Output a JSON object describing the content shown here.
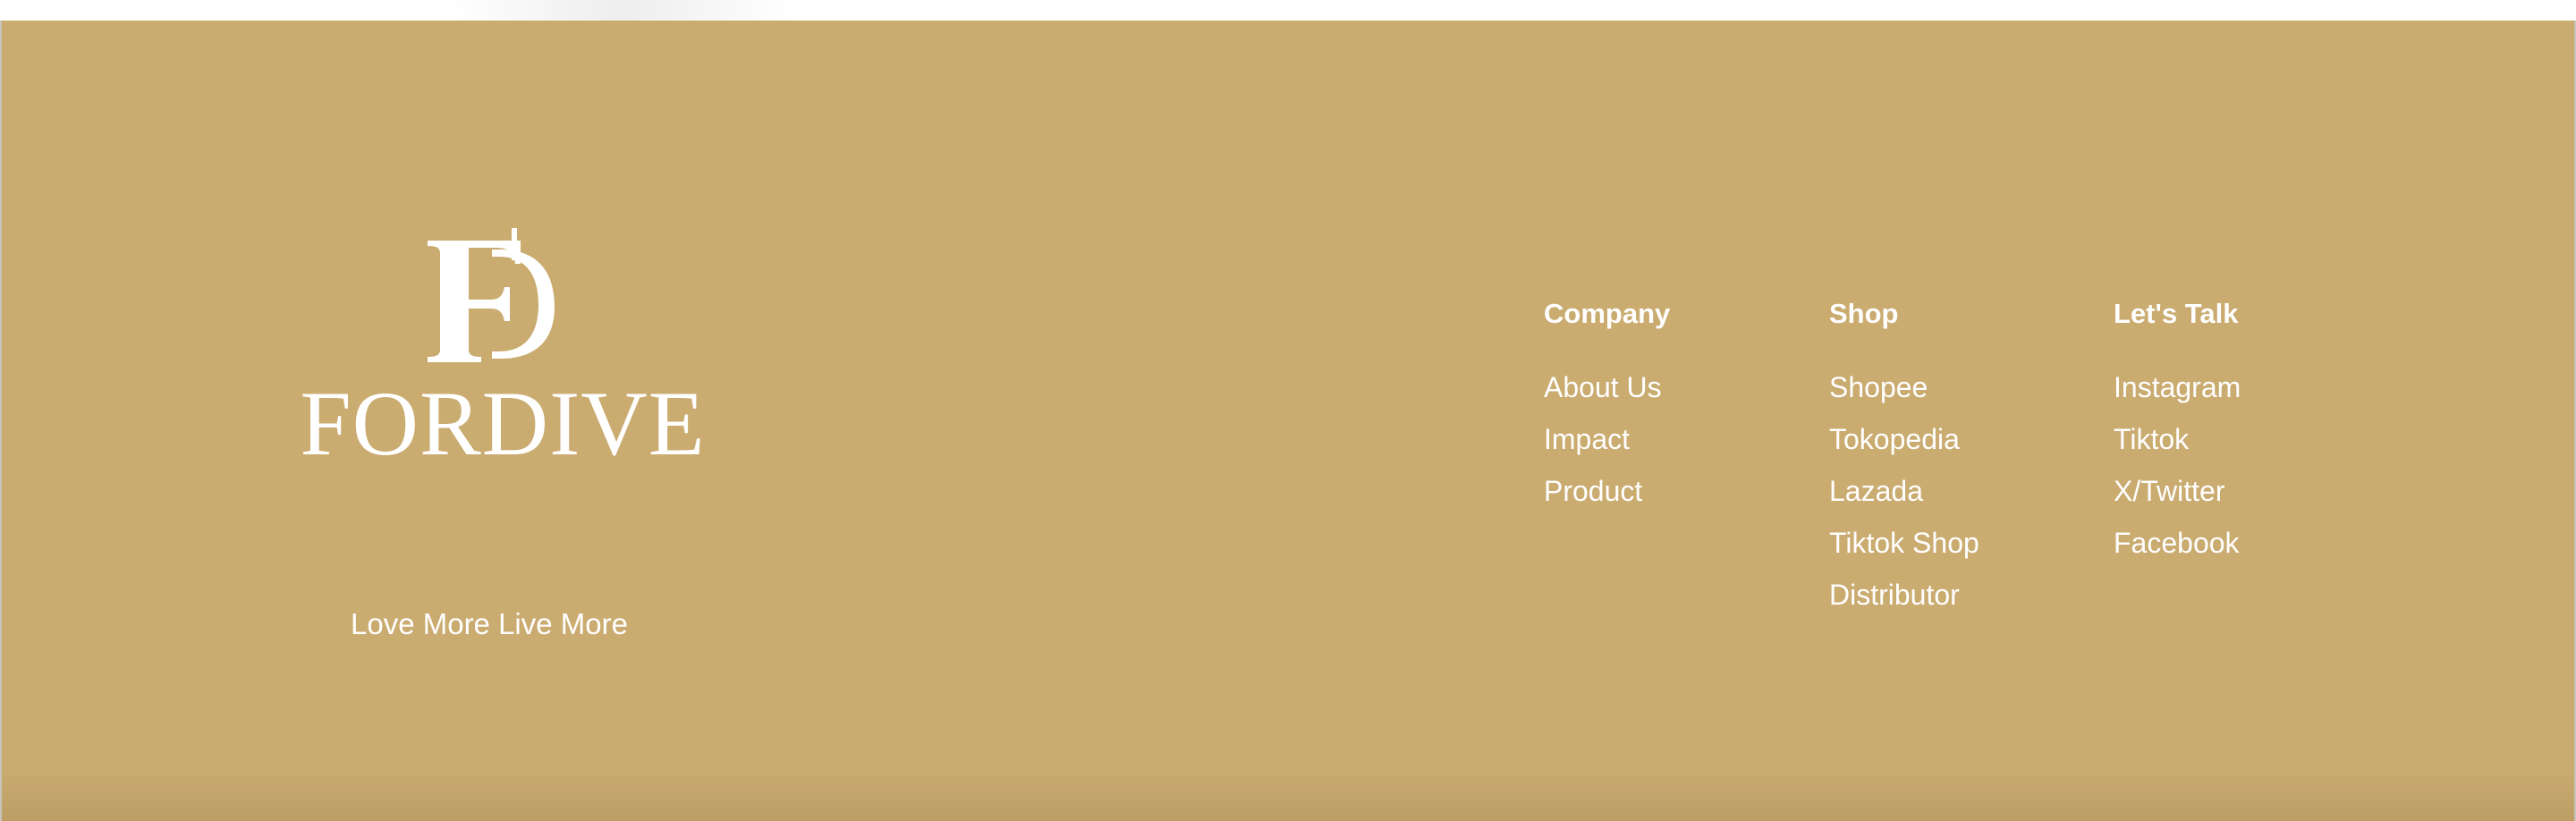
{
  "brand": {
    "monogram": "FD",
    "name": "FORDIVE",
    "tagline": "Love More Live More"
  },
  "columns": {
    "company": {
      "heading": "Company",
      "links": [
        "About Us",
        "Impact",
        "Product"
      ]
    },
    "shop": {
      "heading": "Shop",
      "links": [
        "Shopee",
        "Tokopedia",
        "Lazada",
        "Tiktok Shop",
        "Distributor"
      ]
    },
    "talk": {
      "heading": "Let's Talk",
      "links": [
        "Instagram",
        "Tiktok",
        "X/Twitter",
        "Facebook"
      ]
    }
  },
  "colors": {
    "footer_background": "#caab70",
    "text": "#ffffff"
  }
}
